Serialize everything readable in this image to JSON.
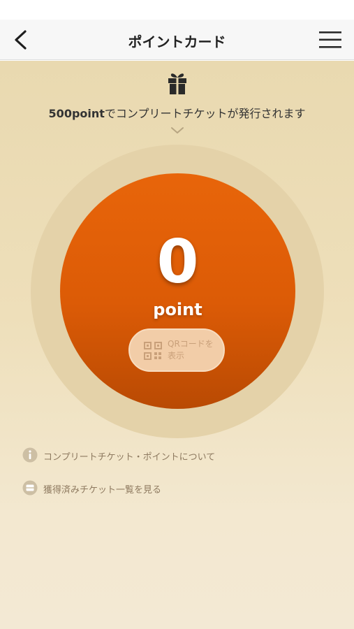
{
  "header": {
    "title": "ポイントカード",
    "back_icon": "chevron-left-icon",
    "menu_icon": "hamburger-menu-icon"
  },
  "complete_notice": {
    "icon": "gift-icon",
    "points_text": "500point",
    "message_text": "でコンプリートチケットが発行されます",
    "expand_icon": "chevron-down-icon"
  },
  "point_card": {
    "value": "0",
    "unit": "point",
    "qr_button": {
      "icon": "qr-code-icon",
      "label_line1": "QRコードを",
      "label_line2": "表示"
    }
  },
  "links": [
    {
      "icon": "info-icon",
      "label": "コンプリートチケット・ポイントについて"
    },
    {
      "icon": "ticket-icon",
      "label": "獲得済みチケット一覧を見る"
    }
  ],
  "colors": {
    "background_top": "#e9d9b0",
    "background_bottom": "#f3e9d4",
    "outer_ring": "#e4d2a9",
    "circle_top": "#e8650a",
    "circle_bottom": "#b94a03",
    "qr_button_bg": "#f2cda8",
    "link_text": "#8e7a60"
  }
}
